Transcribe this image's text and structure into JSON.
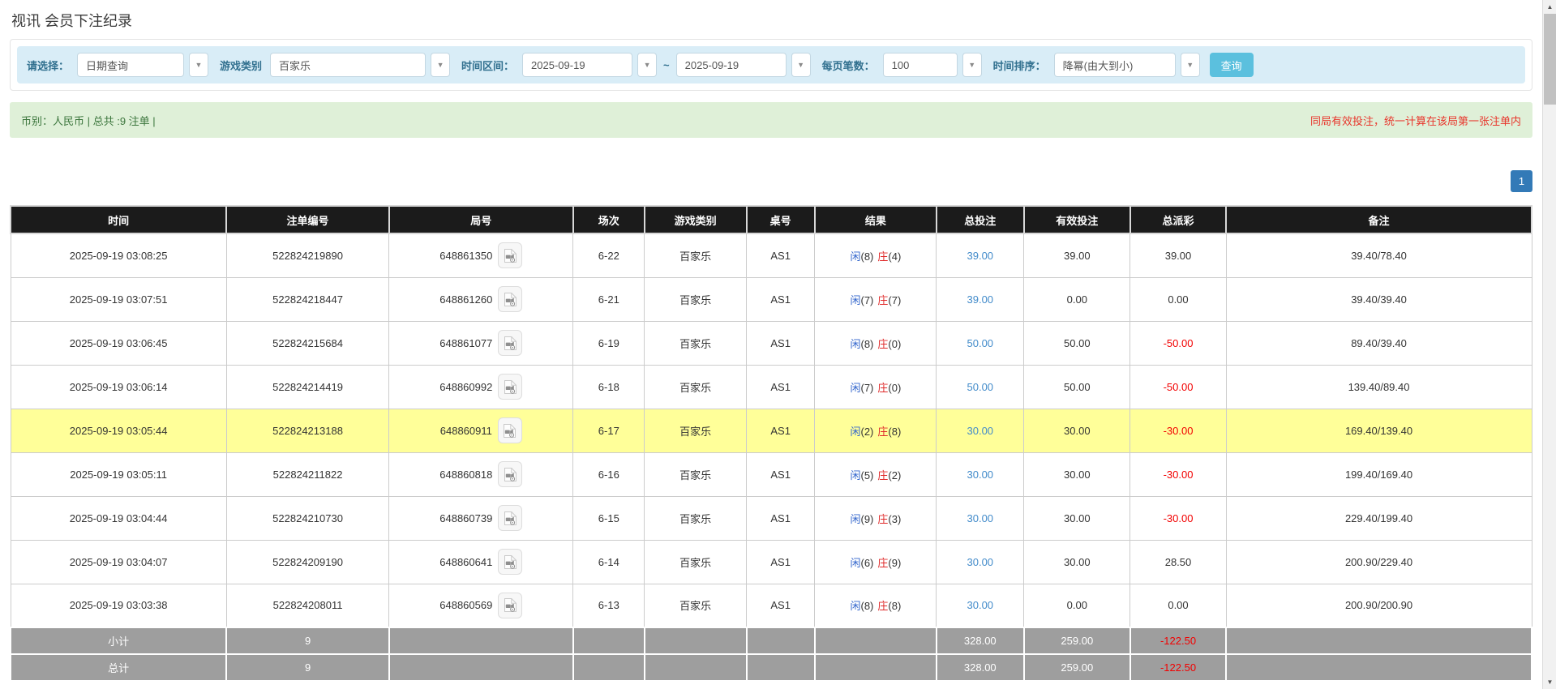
{
  "page": {
    "title": "视讯 会员下注纪录"
  },
  "filters": {
    "select_label": "请选择：",
    "select_value": "日期查询",
    "game_type_label": "游戏类别",
    "game_type_value": "百家乐",
    "time_range_label": "时间区间：",
    "date_from": "2025-09-19",
    "tilde": "~",
    "date_to": "2025-09-19",
    "page_size_label": "每页笔数：",
    "page_size_value": "100",
    "sort_label": "时间排序：",
    "sort_value": "降幂(由大到小)",
    "search_button": "查询"
  },
  "summary": {
    "currency_text": "币别：人民币 | 总共 :9 注单 |",
    "note": "同局有效投注，统一计算在该局第一张注单内"
  },
  "pagination": {
    "current": "1"
  },
  "table": {
    "headers": [
      "时间",
      "注单编号",
      "局号",
      "场次",
      "游戏类别",
      "桌号",
      "结果",
      "总投注",
      "有效投注",
      "总派彩",
      "备注"
    ],
    "rows": [
      {
        "time": "2025-09-19 03:08:25",
        "bet_id": "522824219890",
        "round": "648861350",
        "session": "6-22",
        "game": "百家乐",
        "table_no": "AS1",
        "result_player": "闲",
        "result_player_score": "(8)",
        "result_banker": "庄",
        "result_banker_score": "(4)",
        "total_bet": "39.00",
        "valid_bet": "39.00",
        "payout": "39.00",
        "remark": "39.40/78.40",
        "highlighted": false
      },
      {
        "time": "2025-09-19 03:07:51",
        "bet_id": "522824218447",
        "round": "648861260",
        "session": "6-21",
        "game": "百家乐",
        "table_no": "AS1",
        "result_player": "闲",
        "result_player_score": "(7)",
        "result_banker": "庄",
        "result_banker_score": "(7)",
        "total_bet": "39.00",
        "valid_bet": "0.00",
        "payout": "0.00",
        "remark": "39.40/39.40",
        "highlighted": false
      },
      {
        "time": "2025-09-19 03:06:45",
        "bet_id": "522824215684",
        "round": "648861077",
        "session": "6-19",
        "game": "百家乐",
        "table_no": "AS1",
        "result_player": "闲",
        "result_player_score": "(8)",
        "result_banker": "庄",
        "result_banker_score": "(0)",
        "total_bet": "50.00",
        "valid_bet": "50.00",
        "payout": "-50.00",
        "remark": "89.40/39.40",
        "highlighted": false
      },
      {
        "time": "2025-09-19 03:06:14",
        "bet_id": "522824214419",
        "round": "648860992",
        "session": "6-18",
        "game": "百家乐",
        "table_no": "AS1",
        "result_player": "闲",
        "result_player_score": "(7)",
        "result_banker": "庄",
        "result_banker_score": "(0)",
        "total_bet": "50.00",
        "valid_bet": "50.00",
        "payout": "-50.00",
        "remark": "139.40/89.40",
        "highlighted": false
      },
      {
        "time": "2025-09-19 03:05:44",
        "bet_id": "522824213188",
        "round": "648860911",
        "session": "6-17",
        "game": "百家乐",
        "table_no": "AS1",
        "result_player": "闲",
        "result_player_score": "(2)",
        "result_banker": "庄",
        "result_banker_score": "(8)",
        "total_bet": "30.00",
        "valid_bet": "30.00",
        "payout": "-30.00",
        "remark": "169.40/139.40",
        "highlighted": true
      },
      {
        "time": "2025-09-19 03:05:11",
        "bet_id": "522824211822",
        "round": "648860818",
        "session": "6-16",
        "game": "百家乐",
        "table_no": "AS1",
        "result_player": "闲",
        "result_player_score": "(5)",
        "result_banker": "庄",
        "result_banker_score": "(2)",
        "total_bet": "30.00",
        "valid_bet": "30.00",
        "payout": "-30.00",
        "remark": "199.40/169.40",
        "highlighted": false
      },
      {
        "time": "2025-09-19 03:04:44",
        "bet_id": "522824210730",
        "round": "648860739",
        "session": "6-15",
        "game": "百家乐",
        "table_no": "AS1",
        "result_player": "闲",
        "result_player_score": "(9)",
        "result_banker": "庄",
        "result_banker_score": "(3)",
        "total_bet": "30.00",
        "valid_bet": "30.00",
        "payout": "-30.00",
        "remark": "229.40/199.40",
        "highlighted": false
      },
      {
        "time": "2025-09-19 03:04:07",
        "bet_id": "522824209190",
        "round": "648860641",
        "session": "6-14",
        "game": "百家乐",
        "table_no": "AS1",
        "result_player": "闲",
        "result_player_score": "(6)",
        "result_banker": "庄",
        "result_banker_score": "(9)",
        "total_bet": "30.00",
        "valid_bet": "30.00",
        "payout": "28.50",
        "remark": "200.90/229.40",
        "highlighted": false
      },
      {
        "time": "2025-09-19 03:03:38",
        "bet_id": "522824208011",
        "round": "648860569",
        "session": "6-13",
        "game": "百家乐",
        "table_no": "AS1",
        "result_player": "闲",
        "result_player_score": "(8)",
        "result_banker": "庄",
        "result_banker_score": "(8)",
        "total_bet": "30.00",
        "valid_bet": "0.00",
        "payout": "0.00",
        "remark": "200.90/200.90",
        "highlighted": false
      }
    ],
    "subtotal": {
      "label": "小计",
      "count": "9",
      "total_bet": "328.00",
      "valid_bet": "259.00",
      "payout": "-122.50"
    },
    "total": {
      "label": "总计",
      "count": "9",
      "total_bet": "328.00",
      "valid_bet": "259.00",
      "payout": "-122.50"
    }
  },
  "colors": {
    "filter_bar_bg": "#d9edf7",
    "label_blue": "#31708f",
    "button_blue": "#5bc0de",
    "green_bar_bg": "#dff0d8",
    "green_text": "#3c763d",
    "red_text": "#e8352b",
    "pager_blue": "#337ab7",
    "header_bg": "#1b1b1b",
    "highlight": "#ffff99",
    "total_row_bg": "#9e9e9e",
    "link_blue": "#428bca",
    "player_blue": "#3366cc",
    "banker_red": "#e02b2b",
    "neg_red": "#f20000"
  },
  "icons": {
    "dropdown_caret": "▼",
    "scroll_up": "▲",
    "scroll_down": "▼",
    "video_icon_name": "video-file-icon"
  }
}
